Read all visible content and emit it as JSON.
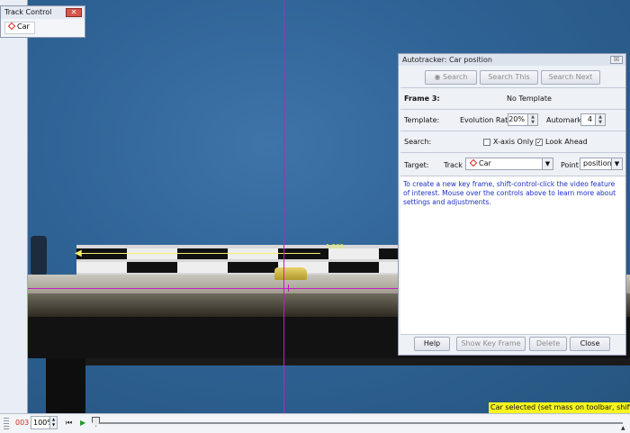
{
  "track_control": {
    "title": "Track Control",
    "close_symbol": "✕",
    "track_button_label": "Car"
  },
  "video": {
    "velocity_label": "1.909"
  },
  "autotracker": {
    "title": "Autotracker: Car position",
    "close_symbol": "☒",
    "buttons": {
      "search": "Search",
      "search_this": "Search This",
      "search_next": "Search Next"
    },
    "frame_label": "Frame 3:",
    "template_status": "No Template",
    "template_label": "Template:",
    "evolution_rate_label": "Evolution Rate",
    "evolution_rate_value": "20%",
    "automark_label": "Automark",
    "automark_value": "4",
    "search_label": "Search:",
    "xaxis_only_label": "X-axis Only",
    "xaxis_only_checked": false,
    "look_ahead_label": "Look Ahead",
    "look_ahead_checked": true,
    "target_label": "Target:",
    "track_label": "Track",
    "track_value": "Car",
    "point_label": "Point",
    "point_value": "position",
    "instructions": "To create a new key frame, shift-control-click the video feature of interest. Mouse over the controls above to learn more about settings and adjustments.",
    "footer": {
      "help": "Help",
      "show_key_frame": "Show Key Frame",
      "delete": "Delete",
      "close": "Close"
    }
  },
  "toolbar": {
    "frame_number": "003",
    "zoom": "100%"
  },
  "status_message": "Car selected (set mass on toolbar, shift",
  "colors": {
    "crosshair": "#c21fbf",
    "status_bg": "#f8f51e",
    "frame_number": "#d12c1e",
    "instructions_text": "#1d31c4"
  }
}
